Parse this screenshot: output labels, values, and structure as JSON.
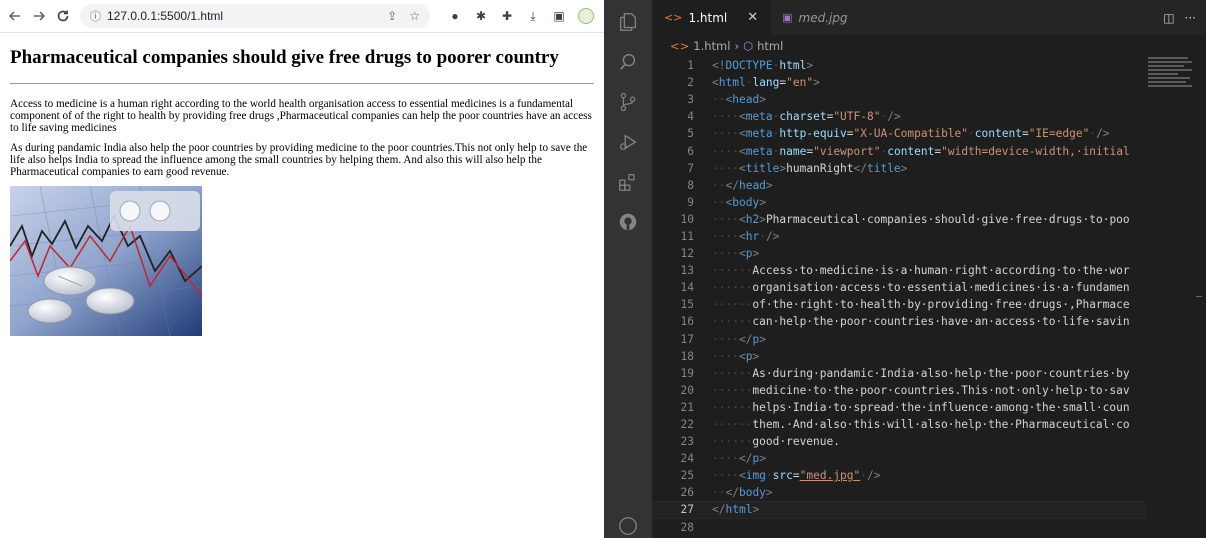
{
  "browser": {
    "url": "127.0.0.1:5500/1.html",
    "heading": "Pharmaceutical companies should give free drugs to poorer country",
    "paragraphs": [
      "Access to medicine is a human right according to the world health organisation access to essential medicines is a fundamental component of of the right to health by providing free drugs ,Pharmaceutical companies can help the poor countries have an access to life saving medicines",
      "As during pandamic India also help the poor countries by providing medicine to the poor countries.This not only help to save the life also helps India to spread the influence among the small countries by helping them. And also this will also help the Pharmaceutical companies to earn good revenue."
    ],
    "image_alt": "med.jpg"
  },
  "vscode": {
    "tabs": [
      {
        "label": "1.html",
        "active": true
      },
      {
        "label": "med.jpg",
        "active": false
      }
    ],
    "breadcrumb": [
      "1.html",
      "html"
    ],
    "current_line": "27",
    "lines": [
      {
        "n": "1",
        "indent": "",
        "tokens": [
          [
            "punct",
            "<!"
          ],
          [
            "tag",
            "DOCTYPE"
          ],
          [
            "ws",
            "·"
          ],
          [
            "attr",
            "html"
          ],
          [
            "punct",
            ">"
          ]
        ]
      },
      {
        "n": "2",
        "indent": "",
        "tokens": [
          [
            "punct",
            "<"
          ],
          [
            "tag",
            "html"
          ],
          [
            "ws",
            "·"
          ],
          [
            "attr",
            "lang"
          ],
          [
            "text",
            "="
          ],
          [
            "str",
            "\"en\""
          ],
          [
            "punct",
            ">"
          ]
        ]
      },
      {
        "n": "3",
        "indent": "··",
        "tokens": [
          [
            "punct",
            "<"
          ],
          [
            "tag",
            "head"
          ],
          [
            "punct",
            ">"
          ]
        ]
      },
      {
        "n": "4",
        "indent": "····",
        "tokens": [
          [
            "punct",
            "<"
          ],
          [
            "tag",
            "meta"
          ],
          [
            "ws",
            "·"
          ],
          [
            "attr",
            "charset"
          ],
          [
            "text",
            "="
          ],
          [
            "str",
            "\"UTF-8\""
          ],
          [
            "ws",
            "·"
          ],
          [
            "punct",
            "/>"
          ]
        ]
      },
      {
        "n": "5",
        "indent": "····",
        "tokens": [
          [
            "punct",
            "<"
          ],
          [
            "tag",
            "meta"
          ],
          [
            "ws",
            "·"
          ],
          [
            "attr",
            "http-equiv"
          ],
          [
            "text",
            "="
          ],
          [
            "str",
            "\"X-UA-Compatible\""
          ],
          [
            "ws",
            "·"
          ],
          [
            "attr",
            "content"
          ],
          [
            "text",
            "="
          ],
          [
            "str",
            "\"IE=edge\""
          ],
          [
            "ws",
            "·"
          ],
          [
            "punct",
            "/>"
          ]
        ]
      },
      {
        "n": "6",
        "indent": "····",
        "tokens": [
          [
            "punct",
            "<"
          ],
          [
            "tag",
            "meta"
          ],
          [
            "ws",
            "·"
          ],
          [
            "attr",
            "name"
          ],
          [
            "text",
            "="
          ],
          [
            "str",
            "\"viewport\""
          ],
          [
            "ws",
            "·"
          ],
          [
            "attr",
            "content"
          ],
          [
            "text",
            "="
          ],
          [
            "str",
            "\"width=device-width,·initial"
          ]
        ]
      },
      {
        "n": "7",
        "indent": "····",
        "tokens": [
          [
            "punct",
            "<"
          ],
          [
            "tag",
            "title"
          ],
          [
            "punct",
            ">"
          ],
          [
            "text",
            "humanRight"
          ],
          [
            "punct",
            "</"
          ],
          [
            "tag",
            "title"
          ],
          [
            "punct",
            ">"
          ]
        ]
      },
      {
        "n": "8",
        "indent": "··",
        "tokens": [
          [
            "punct",
            "</"
          ],
          [
            "tag",
            "head"
          ],
          [
            "punct",
            ">"
          ]
        ]
      },
      {
        "n": "9",
        "indent": "··",
        "tokens": [
          [
            "punct",
            "<"
          ],
          [
            "tag",
            "body"
          ],
          [
            "punct",
            ">"
          ]
        ]
      },
      {
        "n": "10",
        "indent": "····",
        "tokens": [
          [
            "punct",
            "<"
          ],
          [
            "tag",
            "h2"
          ],
          [
            "punct",
            ">"
          ],
          [
            "text",
            "Pharmaceutical·companies·should·give·free·drugs·to·poo"
          ]
        ]
      },
      {
        "n": "11",
        "indent": "····",
        "tokens": [
          [
            "punct",
            "<"
          ],
          [
            "tag",
            "hr"
          ],
          [
            "ws",
            "·"
          ],
          [
            "punct",
            "/>"
          ]
        ]
      },
      {
        "n": "12",
        "indent": "····",
        "tokens": [
          [
            "punct",
            "<"
          ],
          [
            "tag",
            "p"
          ],
          [
            "punct",
            ">"
          ]
        ]
      },
      {
        "n": "13",
        "indent": "······",
        "tokens": [
          [
            "text",
            "Access·to·medicine·is·a·human·right·according·to·the·wor"
          ]
        ]
      },
      {
        "n": "14",
        "indent": "······",
        "tokens": [
          [
            "text",
            "organisation·access·to·essential·medicines·is·a·fundamen"
          ]
        ]
      },
      {
        "n": "15",
        "indent": "······",
        "tokens": [
          [
            "text",
            "of·the·right·to·health·by·providing·free·drugs·,Pharmace"
          ]
        ]
      },
      {
        "n": "16",
        "indent": "······",
        "tokens": [
          [
            "text",
            "can·help·the·poor·countries·have·an·access·to·life·savin"
          ]
        ]
      },
      {
        "n": "17",
        "indent": "····",
        "tokens": [
          [
            "punct",
            "</"
          ],
          [
            "tag",
            "p"
          ],
          [
            "punct",
            ">"
          ]
        ]
      },
      {
        "n": "18",
        "indent": "····",
        "tokens": [
          [
            "punct",
            "<"
          ],
          [
            "tag",
            "p"
          ],
          [
            "punct",
            ">"
          ]
        ]
      },
      {
        "n": "19",
        "indent": "······",
        "tokens": [
          [
            "text",
            "As·during·pandamic·India·also·help·the·poor·countries·by"
          ]
        ]
      },
      {
        "n": "20",
        "indent": "······",
        "tokens": [
          [
            "text",
            "medicine·to·the·poor·countries.This·not·only·help·to·sav"
          ]
        ]
      },
      {
        "n": "21",
        "indent": "······",
        "tokens": [
          [
            "text",
            "helps·India·to·spread·the·influence·among·the·small·coun"
          ]
        ]
      },
      {
        "n": "22",
        "indent": "······",
        "tokens": [
          [
            "text",
            "them.·And·also·this·will·also·help·the·Pharmaceutical·co"
          ]
        ]
      },
      {
        "n": "23",
        "indent": "······",
        "tokens": [
          [
            "text",
            "good·revenue."
          ]
        ]
      },
      {
        "n": "24",
        "indent": "····",
        "tokens": [
          [
            "punct",
            "</"
          ],
          [
            "tag",
            "p"
          ],
          [
            "punct",
            ">"
          ]
        ]
      },
      {
        "n": "25",
        "indent": "····",
        "tokens": [
          [
            "punct",
            "<"
          ],
          [
            "tag",
            "img"
          ],
          [
            "ws",
            "·"
          ],
          [
            "attr",
            "src"
          ],
          [
            "text",
            "="
          ],
          [
            "link",
            "\"med.jpg\""
          ],
          [
            "ws",
            "·"
          ],
          [
            "punct",
            "/>"
          ]
        ]
      },
      {
        "n": "26",
        "indent": "··",
        "tokens": [
          [
            "punct",
            "</"
          ],
          [
            "tag",
            "body"
          ],
          [
            "punct",
            ">"
          ]
        ]
      },
      {
        "n": "27",
        "indent": "",
        "tokens": [
          [
            "punct",
            "</"
          ],
          [
            "tag",
            "html"
          ],
          [
            "punct",
            ">"
          ]
        ]
      },
      {
        "n": "28",
        "indent": "",
        "tokens": []
      }
    ]
  },
  "colors": {
    "editor_bg": "#1e1e1e",
    "activity_bar": "#333333",
    "tag": "#569cd6",
    "attr": "#9cdcfe",
    "string": "#ce9178"
  }
}
